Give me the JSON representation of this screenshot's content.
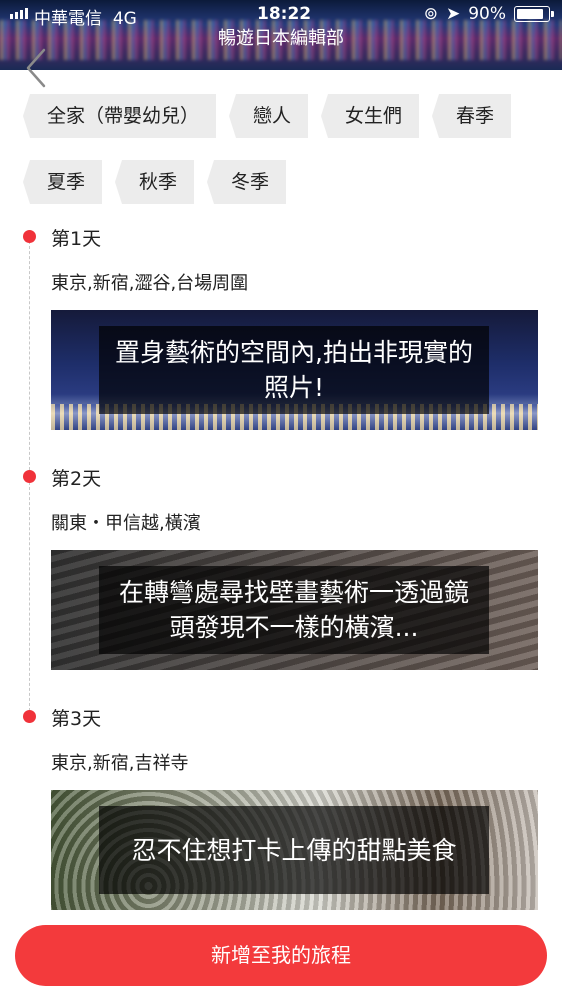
{
  "status_bar": {
    "carrier": "中華電信",
    "network": "4G",
    "time": "18:22",
    "battery": "90%"
  },
  "header": {
    "title": "暢遊日本編輯部",
    "back_icon": "chevron-left-icon"
  },
  "tags": [
    "全家（帶嬰幼兒）",
    "戀人",
    "女生們",
    "春季",
    "夏季",
    "秋季",
    "冬季"
  ],
  "days": [
    {
      "title": "第1天",
      "places": "東京,新宿,澀谷,台場周圍",
      "caption": "置身藝術的空間內,拍出非現實的照片!"
    },
    {
      "title": "第2天",
      "places": "關東・甲信越,橫濱",
      "caption": "在轉彎處尋找壁畫藝術一透過鏡頭發現不一樣的橫濱..."
    },
    {
      "title": "第3天",
      "places": "東京,新宿,吉祥寺",
      "caption": "忍不住想打卡上傳的甜點美食"
    }
  ],
  "add_button": {
    "label": "新增至我的旅程"
  },
  "colors": {
    "accent": "#f33a3c",
    "timeline_dot": "#f0323a",
    "tag_bg": "#ececec"
  }
}
